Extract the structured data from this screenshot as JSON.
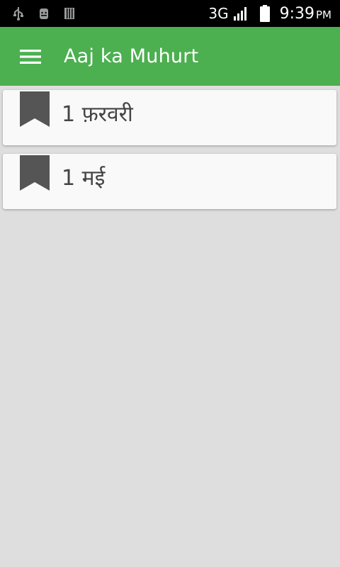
{
  "status_bar": {
    "icons": [
      "usb-icon",
      "android-debug-icon",
      "storage-icon"
    ],
    "network": "3G",
    "signal_icon": "signal-icon",
    "battery_icon": "battery-icon",
    "time": "9:39",
    "ampm": "PM"
  },
  "toolbar": {
    "menu_icon": "hamburger-menu-icon",
    "title": "Aaj ka Muhurt",
    "background": "#4caf50"
  },
  "list": {
    "items": [
      {
        "label": "1 फ़रवरी",
        "icon": "bookmark-icon"
      },
      {
        "label": "1 मई",
        "icon": "bookmark-icon"
      }
    ]
  }
}
